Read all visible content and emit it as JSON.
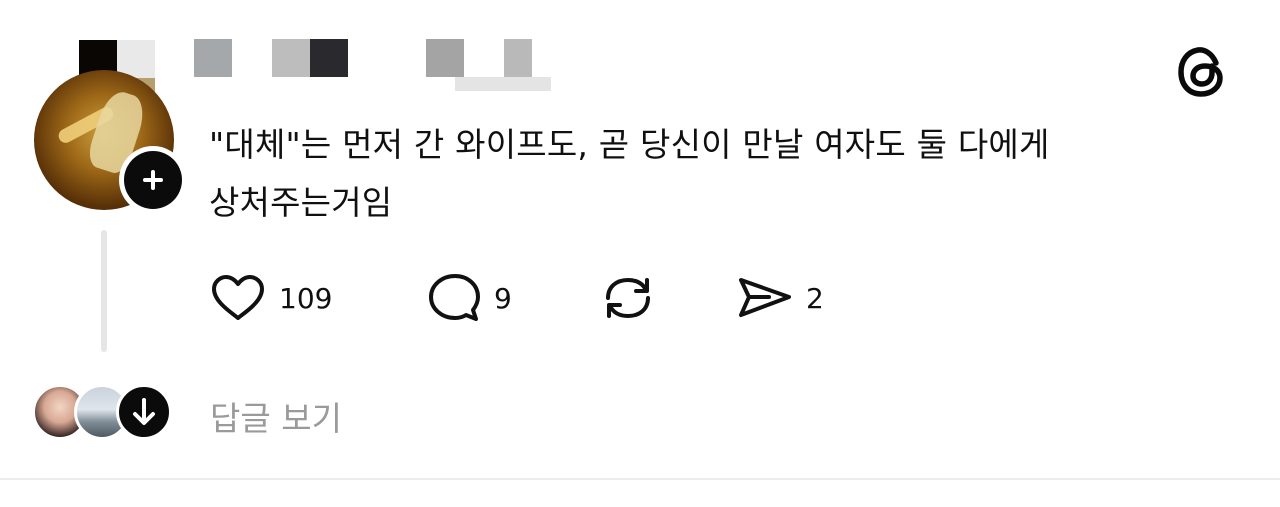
{
  "post": {
    "text_line1": "\"대체\"는 먼저 간 와이프도, 곧 당신이 만날 여자도 둘 다에게",
    "text_line2": "상처주는거임"
  },
  "actions": {
    "like_count": "109",
    "comment_count": "9",
    "share_count": "2",
    "icons": [
      "heart-icon",
      "comment-icon",
      "repost-icon",
      "send-icon"
    ]
  },
  "replies": {
    "view_label": "답글 보기"
  }
}
